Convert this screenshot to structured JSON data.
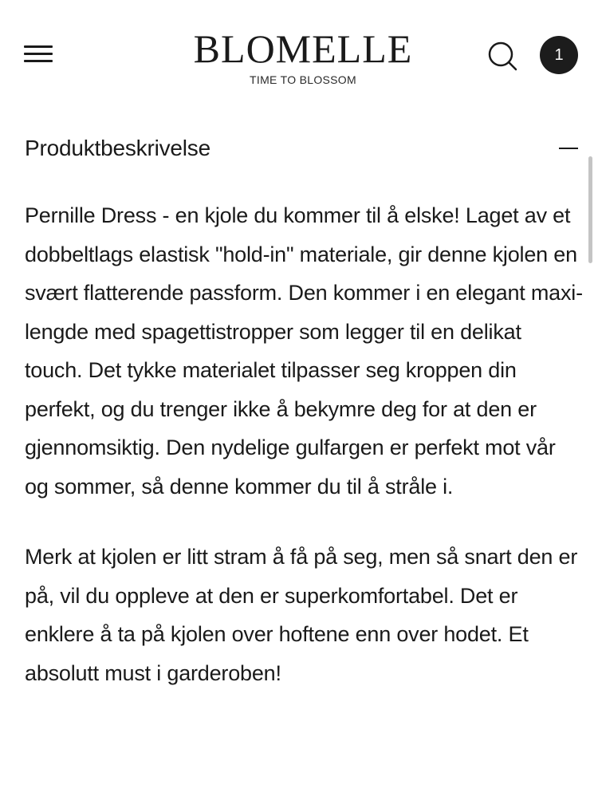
{
  "header": {
    "logo_text": "BLOMELLE",
    "tagline": "TIME TO BLOSSOM",
    "cart_count": "1"
  },
  "section": {
    "title": "Produktbeskrivelse"
  },
  "description": {
    "paragraphs": [
      "Pernille Dress - en kjole du kommer til å elske! Laget av et dobbeltlags elastisk \"hold-in\" materiale, gir denne kjolen en svært flatterende passform. Den kommer i en elegant maxi-lengde med spagettistropper som legger til en delikat touch. Det tykke materialet tilpasser seg kroppen din perfekt, og du trenger ikke å bekymre deg for at den er gjennomsiktig. Den nydelige gulfargen er perfekt mot vår og sommer, så denne kommer du til å stråle i.",
      "Merk at kjolen er litt stram å få på seg, men så snart den er på, vil du oppleve at den er superkomfortabel. Det er enklere å ta på kjolen over hoftene enn over hodet. Et absolutt must i garderoben!"
    ]
  },
  "icons": {
    "menu": "hamburger-menu-icon",
    "search": "search-icon",
    "collapse": "minus-icon"
  },
  "colors": {
    "text": "#1a1a1a",
    "cart_badge": "#1c1c1c",
    "background": "#ffffff"
  }
}
